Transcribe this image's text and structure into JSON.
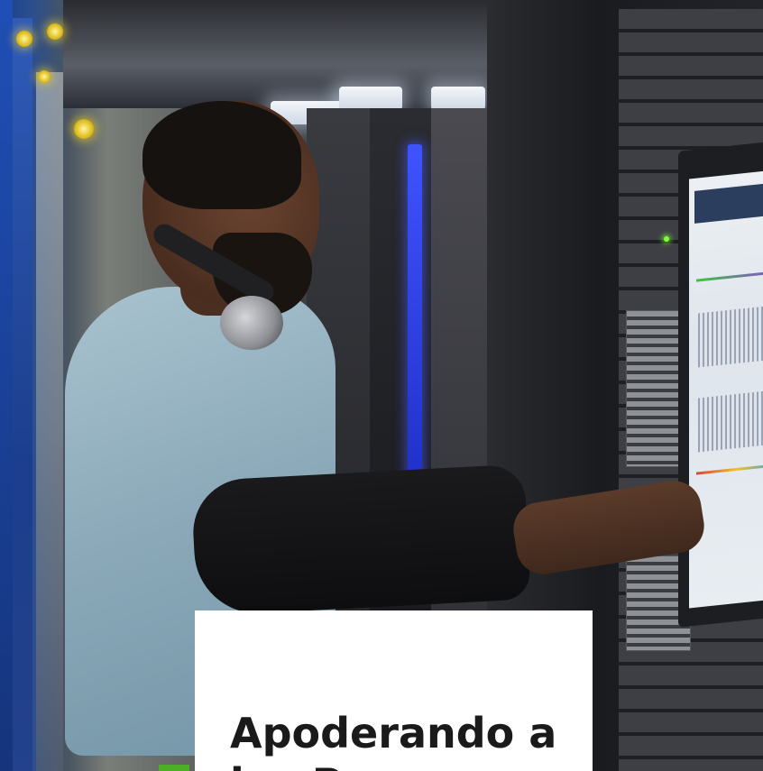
{
  "hero": {
    "image_alt": "",
    "card": {
      "title_line1": "Apoderando a",
      "title_line2": "los P"
    }
  },
  "colors": {
    "card_background": "#ffffff",
    "title_text": "#1a1a1a",
    "rack_blue": "#1f4fb5",
    "accent_green": "#4caf26"
  }
}
